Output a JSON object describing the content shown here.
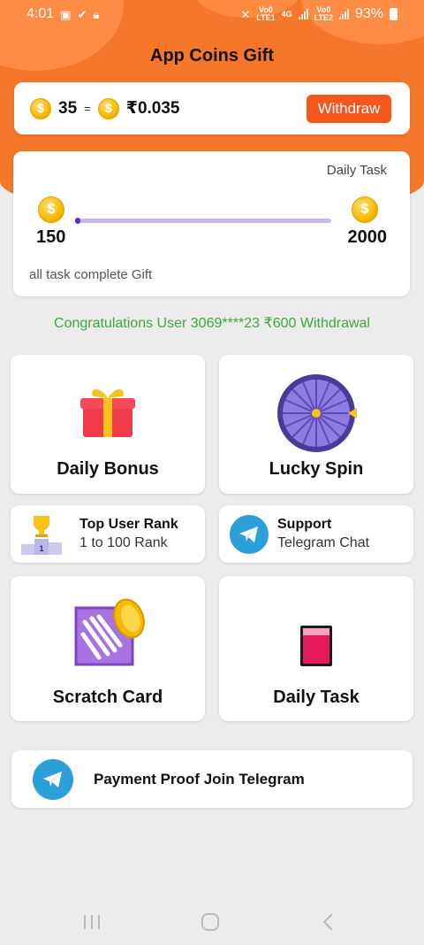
{
  "status_bar": {
    "time": "4:01",
    "net1": "Vo0\nLTE1",
    "net_4g": "4G",
    "net2": "Vo0\nLTE2",
    "battery": "93%"
  },
  "app": {
    "title": "App Coins Gift"
  },
  "balance": {
    "coins": "35",
    "equals": "=",
    "rupees": "₹0.035",
    "withdraw_label": "Withdraw"
  },
  "daily_task_card": {
    "label": "Daily Task",
    "min_value": "150",
    "max_value": "2000",
    "progress_fraction": 0.02,
    "footer": "all task complete Gift"
  },
  "congrats_text": "Congratulations User 3069****23 ₹600 Withdrawal",
  "tiles": {
    "daily_bonus": "Daily Bonus",
    "lucky_spin": "Lucky Spin",
    "scratch_card": "Scratch Card",
    "daily_task": "Daily Task"
  },
  "top_rank": {
    "title": "Top User Rank",
    "subtitle": "1 to 100 Rank"
  },
  "support": {
    "title": "Support",
    "subtitle": "Telegram Chat"
  },
  "payment_proof": {
    "label": "Payment Proof Join Telegram"
  },
  "colors": {
    "accent_orange": "#f5772a",
    "withdraw_button": "#f5561c",
    "congrats_green": "#3aab3a",
    "progress": "#5a2fc8",
    "telegram_blue": "#2a9fd8"
  },
  "icons": {
    "coin": "rupee-coin-icon",
    "gift": "gift-icon",
    "wheel": "spin-wheel-icon",
    "trophy": "trophy-podium-icon",
    "telegram": "telegram-icon",
    "scratch": "scratch-card-icon",
    "task": "task-jar-icon"
  }
}
